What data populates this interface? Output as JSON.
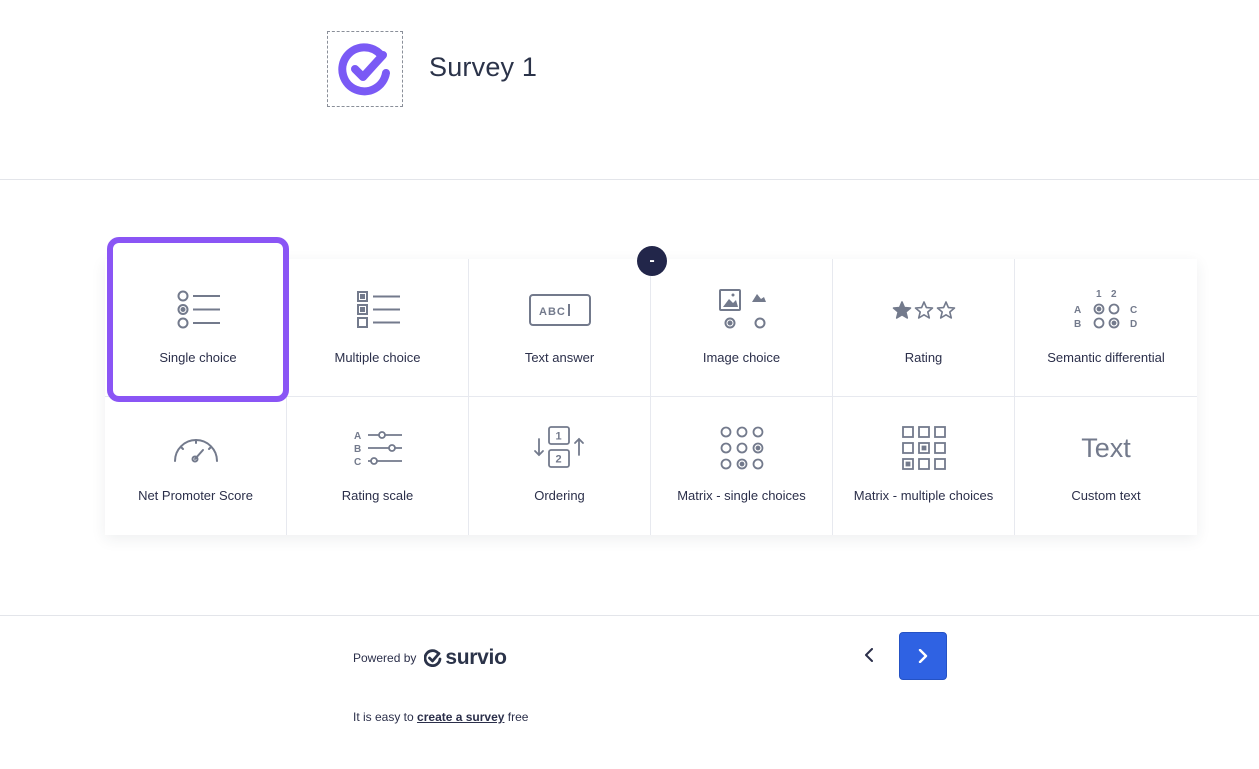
{
  "header": {
    "title": "Survey 1",
    "logo_icon": "check-circle-icon"
  },
  "colors": {
    "accent_purple": "#8a55f5",
    "primary_blue": "#2f62e3",
    "dark_navy": "#22264a",
    "icon_gray": "#737a8c"
  },
  "question_types": {
    "remove_label": "-",
    "items": [
      {
        "label": "Single choice",
        "icon": "single-choice-icon",
        "selected": true
      },
      {
        "label": "Multiple choice",
        "icon": "multiple-choice-icon"
      },
      {
        "label": "Text answer",
        "icon": "text-answer-icon",
        "icon_text": "ABC"
      },
      {
        "label": "Image choice",
        "icon": "image-choice-icon"
      },
      {
        "label": "Rating",
        "icon": "rating-stars-icon"
      },
      {
        "label": "Semantic differential",
        "icon": "semantic-differential-icon",
        "icon_text": [
          "1",
          "2",
          "A",
          "C",
          "B",
          "D"
        ]
      },
      {
        "label": "Net Promoter Score",
        "icon": "gauge-icon"
      },
      {
        "label": "Rating scale",
        "icon": "rating-scale-icon",
        "icon_text": [
          "A",
          "B",
          "C"
        ]
      },
      {
        "label": "Ordering",
        "icon": "ordering-icon",
        "icon_text": [
          "1",
          "2"
        ]
      },
      {
        "label": "Matrix - single choices",
        "icon": "matrix-single-icon"
      },
      {
        "label": "Matrix - multiple choices",
        "icon": "matrix-multiple-icon"
      },
      {
        "label": "Custom text",
        "icon": "custom-text-icon",
        "icon_text": "Text"
      }
    ]
  },
  "footer": {
    "powered_by": "Powered by",
    "brand": "survio",
    "easy_prefix": "It is easy to",
    "easy_link": "create a survey",
    "easy_suffix": "free"
  }
}
